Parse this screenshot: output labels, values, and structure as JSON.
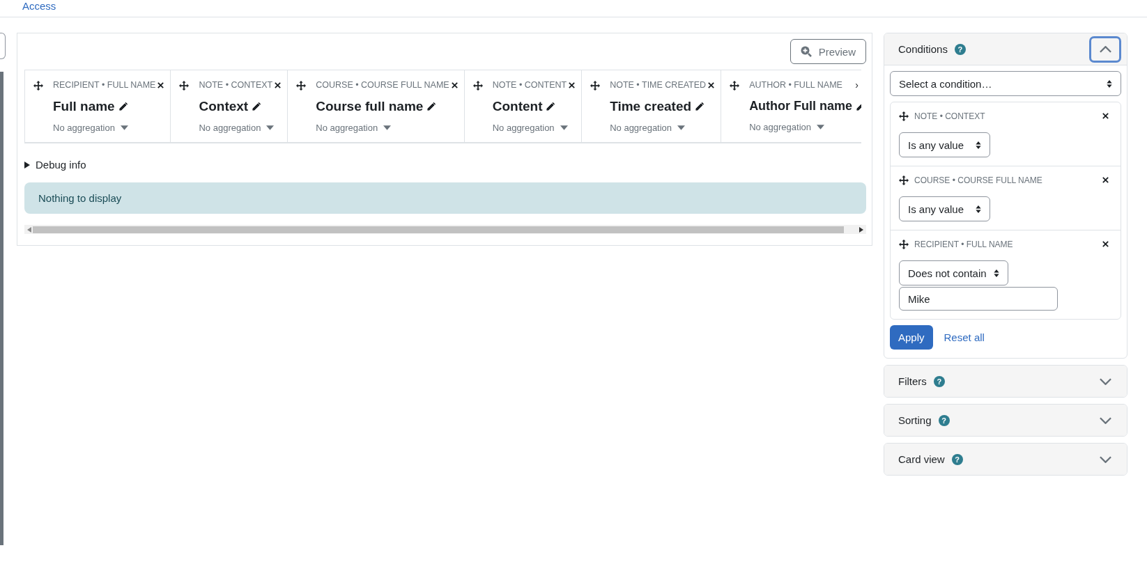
{
  "nav": {
    "link": "Access"
  },
  "report": {
    "preview_button": "Preview",
    "columns": [
      {
        "category": "RECIPIENT • FULL NAME",
        "title": "Full name",
        "aggregation": "No aggregation",
        "removable": true
      },
      {
        "category": "NOTE • CONTEXT",
        "title": "Context",
        "aggregation": "No aggregation",
        "removable": true
      },
      {
        "category": "COURSE • COURSE FULL NAME",
        "title": "Course full name",
        "aggregation": "No aggregation",
        "removable": true
      },
      {
        "category": "NOTE • CONTENT",
        "title": "Content",
        "aggregation": "No aggregation",
        "removable": true
      },
      {
        "category": "NOTE • TIME CREATED",
        "title": "Time created",
        "aggregation": "No aggregation",
        "removable": true
      },
      {
        "category": "AUTHOR • FULL NAME",
        "title": "Author Full name",
        "aggregation": "No aggregation",
        "removable": false,
        "overflow_mark": "›"
      }
    ],
    "debug_label": "Debug info",
    "empty_message": "Nothing to display"
  },
  "sidebar": {
    "sections": [
      {
        "title": "Conditions",
        "help_mark": "?",
        "expanded": true,
        "select_placeholder": "Select a condition…",
        "conditions": [
          {
            "category": "NOTE • CONTEXT",
            "operator": "Is any value"
          },
          {
            "category": "COURSE • COURSE FULL NAME",
            "operator": "Is any value"
          },
          {
            "category": "RECIPIENT • FULL NAME",
            "operator": "Does not contain",
            "value": "Mike"
          }
        ],
        "apply_button": "Apply",
        "reset_link": "Reset all"
      },
      {
        "title": "Filters",
        "help_mark": "?",
        "expanded": false
      },
      {
        "title": "Sorting",
        "help_mark": "?",
        "expanded": false
      },
      {
        "title": "Card view",
        "help_mark": "?",
        "expanded": false
      }
    ]
  }
}
